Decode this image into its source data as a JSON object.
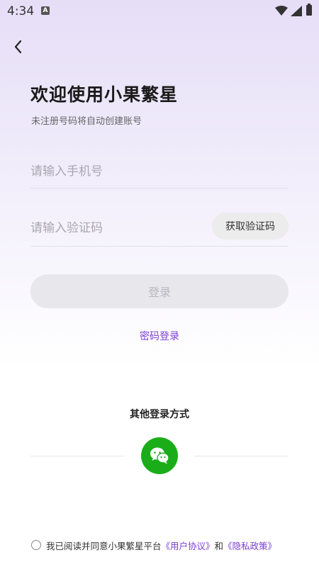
{
  "status_bar": {
    "time": "4:34",
    "a_label": "A"
  },
  "header": {
    "title": "欢迎使用小果繁星",
    "subtitle": "未注册号码将自动创建账号"
  },
  "form": {
    "phone_placeholder": "请输入手机号",
    "code_placeholder": "请输入验证码",
    "get_code_label": "获取验证码",
    "login_label": "登录",
    "password_login_label": "密码登录"
  },
  "other_login": {
    "title": "其他登录方式"
  },
  "agreement": {
    "prefix": "我已阅读并同意小果繁星平台",
    "user_agreement": "《用户协议》",
    "conjunction": "和",
    "privacy_policy": "《隐私政策》"
  },
  "colors": {
    "accent": "#7b3fd2",
    "wechat": "#1aad19"
  }
}
